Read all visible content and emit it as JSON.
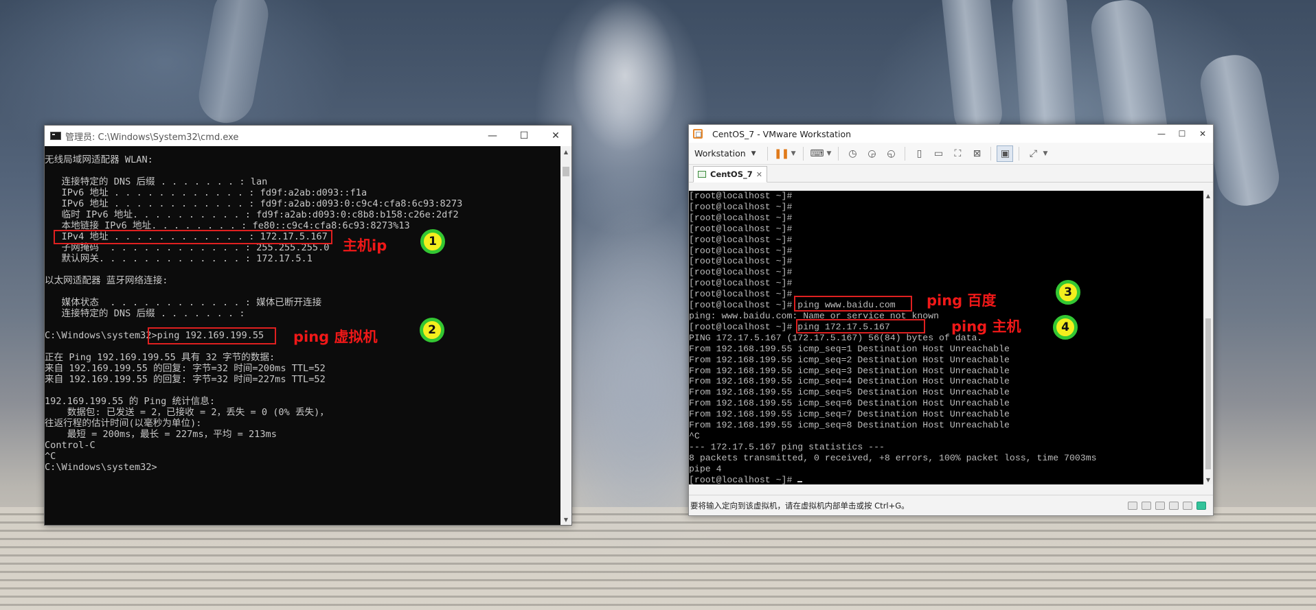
{
  "cmd_window": {
    "title": "管理员: C:\\Windows\\System32\\cmd.exe",
    "buttons": {
      "minimize": "—",
      "maximize": "☐",
      "close": "✕"
    },
    "lines": [
      "无线局域网适配器 WLAN:",
      "",
      "   连接特定的 DNS 后缀 . . . . . . . : lan",
      "   IPv6 地址 . . . . . . . . . . . . : fd9f:a2ab:d093::f1a",
      "   IPv6 地址 . . . . . . . . . . . . : fd9f:a2ab:d093:0:c9c4:cfa8:6c93:8273",
      "   临时 IPv6 地址. . . . . . . . . . : fd9f:a2ab:d093:0:c8b8:b158:c26e:2df2",
      "   本地链接 IPv6 地址. . . . . . . . : fe80::c9c4:cfa8:6c93:8273%13",
      "   IPv4 地址 . . . . . . . . . . . . : 172.17.5.167",
      "   子网掩码  . . . . . . . . . . . . : 255.255.255.0",
      "   默认网关. . . . . . . . . . . . . : 172.17.5.1",
      "",
      "以太网适配器 蓝牙网络连接:",
      "",
      "   媒体状态  . . . . . . . . . . . . : 媒体已断开连接",
      "   连接特定的 DNS 后缀 . . . . . . . :",
      "",
      "C:\\Windows\\system32>ping 192.169.199.55",
      "",
      "正在 Ping 192.169.199.55 具有 32 字节的数据:",
      "来自 192.169.199.55 的回复: 字节=32 时间=200ms TTL=52",
      "来自 192.169.199.55 的回复: 字节=32 时间=227ms TTL=52",
      "",
      "192.169.199.55 的 Ping 统计信息:",
      "    数据包: 已发送 = 2，已接收 = 2，丢失 = 0 (0% 丢失)，",
      "往返行程的估计时间(以毫秒为单位):",
      "    最短 = 200ms，最长 = 227ms，平均 = 213ms",
      "Control-C",
      "^C",
      "C:\\Windows\\system32>"
    ]
  },
  "vm_window": {
    "title": "CentOS_7 - VMware Workstation",
    "buttons": {
      "minimize": "—",
      "maximize": "☐",
      "close": "✕"
    },
    "toolbar": {
      "menu_label": "Workstation",
      "menu_caret": "▼",
      "pause_glyph": "❚❚",
      "icons": [
        "send-keys-icon",
        "snapshot-icon",
        "revert-snapshot-icon",
        "snapshot-manager-icon",
        "sidebar-icon",
        "thumbnail-bar-icon",
        "fullscreen-icon",
        "unity-icon",
        "console-view-icon",
        "stretch-view-icon"
      ]
    },
    "tab": {
      "label": "CentOS_7",
      "close": "✕"
    },
    "console_lines": [
      "[root@localhost ~]#",
      "[root@localhost ~]#",
      "[root@localhost ~]#",
      "[root@localhost ~]#",
      "[root@localhost ~]#",
      "[root@localhost ~]#",
      "[root@localhost ~]#",
      "[root@localhost ~]#",
      "[root@localhost ~]#",
      "[root@localhost ~]#",
      "[root@localhost ~]# ping www.baidu.com",
      "ping: www.baidu.com: Name or service not known",
      "[root@localhost ~]# ping 172.17.5.167",
      "PING 172.17.5.167 (172.17.5.167) 56(84) bytes of data.",
      "From 192.168.199.55 icmp_seq=1 Destination Host Unreachable",
      "From 192.168.199.55 icmp_seq=2 Destination Host Unreachable",
      "From 192.168.199.55 icmp_seq=3 Destination Host Unreachable",
      "From 192.168.199.55 icmp_seq=4 Destination Host Unreachable",
      "From 192.168.199.55 icmp_seq=5 Destination Host Unreachable",
      "From 192.168.199.55 icmp_seq=6 Destination Host Unreachable",
      "From 192.168.199.55 icmp_seq=7 Destination Host Unreachable",
      "From 192.168.199.55 icmp_seq=8 Destination Host Unreachable",
      "^C",
      "--- 172.17.5.167 ping statistics ---",
      "8 packets transmitted, 0 received, +8 errors, 100% packet loss, time 7003ms",
      "pipe 4",
      "[root@localhost ~]# "
    ],
    "status_text": "要将输入定向到该虚拟机，请在虚拟机内部单击或按 Ctrl+G。"
  },
  "annotations": {
    "host_ip": {
      "label": "主机ip",
      "badge": "1"
    },
    "ping_vm": {
      "label": "ping 虚拟机",
      "badge": "2"
    },
    "ping_baidu": {
      "label": "ping 百度",
      "badge": "3"
    },
    "ping_host": {
      "label": "ping 主机",
      "badge": "4"
    }
  }
}
